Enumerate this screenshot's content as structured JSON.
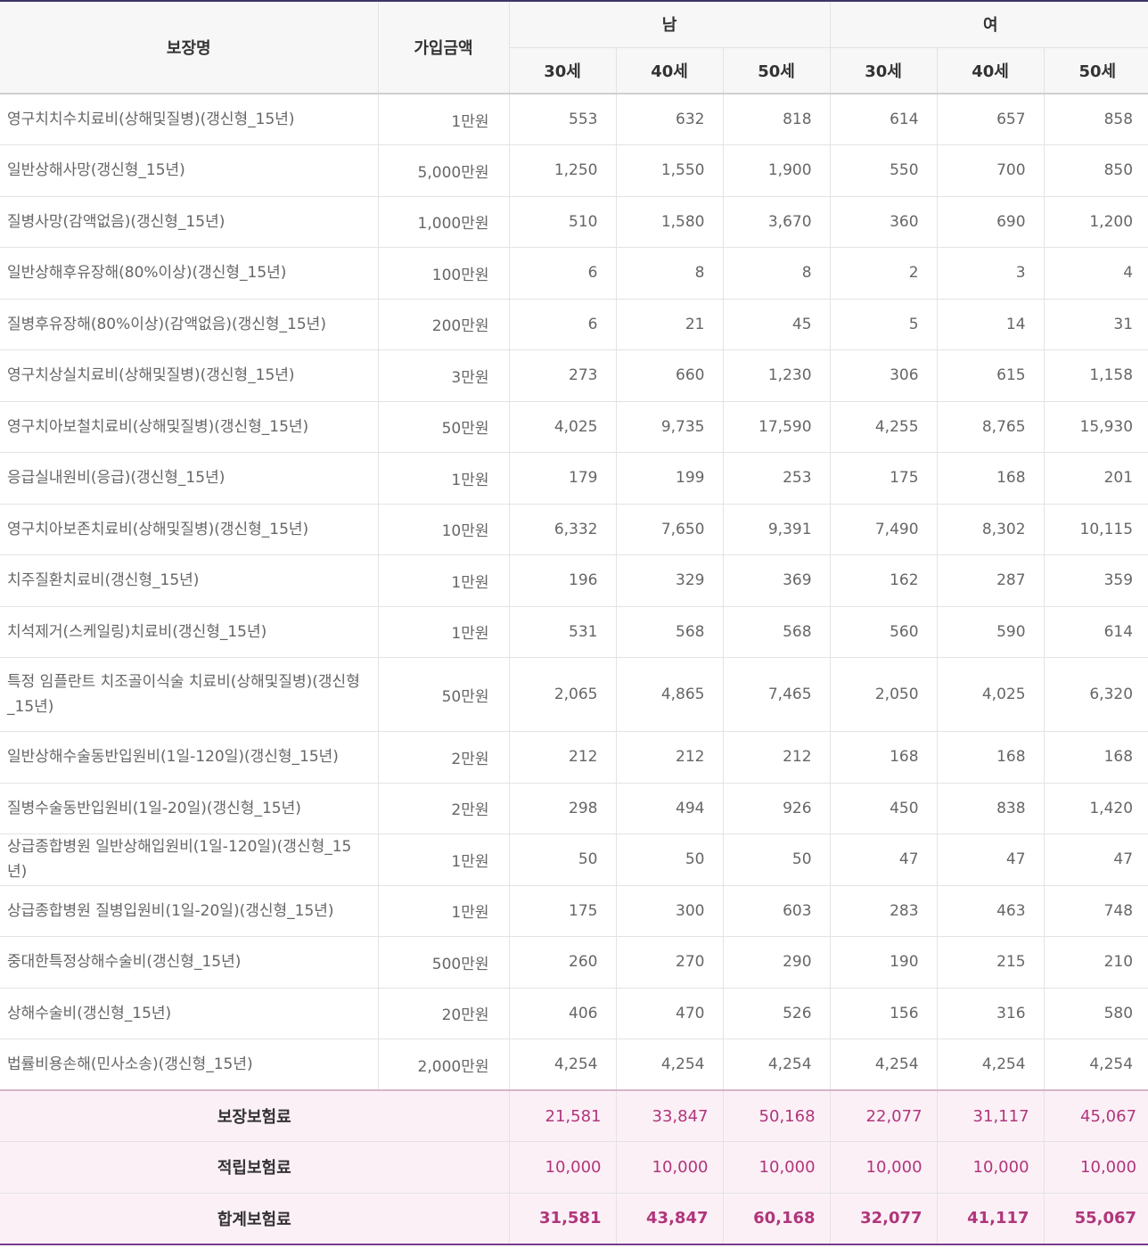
{
  "headers": {
    "name": "보장명",
    "amount": "가입금액",
    "groups": [
      "남",
      "여"
    ],
    "ages": [
      "30세",
      "40세",
      "50세",
      "30세",
      "40세",
      "50세"
    ]
  },
  "rows": [
    {
      "name": "영구치치수치료비(상해및질병)(갱신형_15년)",
      "amount": "1만원",
      "values": [
        "553",
        "632",
        "818",
        "614",
        "657",
        "858"
      ]
    },
    {
      "name": "일반상해사망(갱신형_15년)",
      "amount": "5,000만원",
      "values": [
        "1,250",
        "1,550",
        "1,900",
        "550",
        "700",
        "850"
      ]
    },
    {
      "name": "질병사망(감액없음)(갱신형_15년)",
      "amount": "1,000만원",
      "values": [
        "510",
        "1,580",
        "3,670",
        "360",
        "690",
        "1,200"
      ]
    },
    {
      "name": "일반상해후유장해(80%이상)(갱신형_15년)",
      "amount": "100만원",
      "values": [
        "6",
        "8",
        "8",
        "2",
        "3",
        "4"
      ]
    },
    {
      "name": "질병후유장해(80%이상)(감액없음)(갱신형_15년)",
      "amount": "200만원",
      "values": [
        "6",
        "21",
        "45",
        "5",
        "14",
        "31"
      ]
    },
    {
      "name": "영구치상실치료비(상해및질병)(갱신형_15년)",
      "amount": "3만원",
      "values": [
        "273",
        "660",
        "1,230",
        "306",
        "615",
        "1,158"
      ]
    },
    {
      "name": "영구치아보철치료비(상해및질병)(갱신형_15년)",
      "amount": "50만원",
      "values": [
        "4,025",
        "9,735",
        "17,590",
        "4,255",
        "8,765",
        "15,930"
      ]
    },
    {
      "name": "응급실내원비(응급)(갱신형_15년)",
      "amount": "1만원",
      "values": [
        "179",
        "199",
        "253",
        "175",
        "168",
        "201"
      ]
    },
    {
      "name": "영구치아보존치료비(상해및질병)(갱신형_15년)",
      "amount": "10만원",
      "values": [
        "6,332",
        "7,650",
        "9,391",
        "7,490",
        "8,302",
        "10,115"
      ]
    },
    {
      "name": "치주질환치료비(갱신형_15년)",
      "amount": "1만원",
      "values": [
        "196",
        "329",
        "369",
        "162",
        "287",
        "359"
      ]
    },
    {
      "name": "치석제거(스케일링)치료비(갱신형_15년)",
      "amount": "1만원",
      "values": [
        "531",
        "568",
        "568",
        "560",
        "590",
        "614"
      ]
    },
    {
      "name": "특정 임플란트 치조골이식술 치료비(상해및질병)(갱신형_15년)",
      "amount": "50만원",
      "values": [
        "2,065",
        "4,865",
        "7,465",
        "2,050",
        "4,025",
        "6,320"
      ]
    },
    {
      "name": "일반상해수술동반입원비(1일-120일)(갱신형_15년)",
      "amount": "2만원",
      "values": [
        "212",
        "212",
        "212",
        "168",
        "168",
        "168"
      ]
    },
    {
      "name": "질병수술동반입원비(1일-20일)(갱신형_15년)",
      "amount": "2만원",
      "values": [
        "298",
        "494",
        "926",
        "450",
        "838",
        "1,420"
      ]
    },
    {
      "name": "상급종합병원 일반상해입원비(1일-120일)(갱신형_15년)",
      "amount": "1만원",
      "values": [
        "50",
        "50",
        "50",
        "47",
        "47",
        "47"
      ]
    },
    {
      "name": "상급종합병원 질병입원비(1일-20일)(갱신형_15년)",
      "amount": "1만원",
      "values": [
        "175",
        "300",
        "603",
        "283",
        "463",
        "748"
      ]
    },
    {
      "name": "중대한특정상해수술비(갱신형_15년)",
      "amount": "500만원",
      "values": [
        "260",
        "270",
        "290",
        "190",
        "215",
        "210"
      ]
    },
    {
      "name": "상해수술비(갱신형_15년)",
      "amount": "20만원",
      "values": [
        "406",
        "470",
        "526",
        "156",
        "316",
        "580"
      ]
    },
    {
      "name": "법률비용손해(민사소송)(갱신형_15년)",
      "amount": "2,000만원",
      "values": [
        "4,254",
        "4,254",
        "4,254",
        "4,254",
        "4,254",
        "4,254"
      ]
    }
  ],
  "totals": [
    {
      "label": "보장보험료",
      "values": [
        "21,581",
        "33,847",
        "50,168",
        "22,077",
        "31,117",
        "45,067"
      ]
    },
    {
      "label": "적립보험료",
      "values": [
        "10,000",
        "10,000",
        "10,000",
        "10,000",
        "10,000",
        "10,000"
      ]
    },
    {
      "label": "합계보험료",
      "values": [
        "31,581",
        "43,847",
        "60,168",
        "32,077",
        "41,117",
        "55,067"
      ]
    }
  ]
}
